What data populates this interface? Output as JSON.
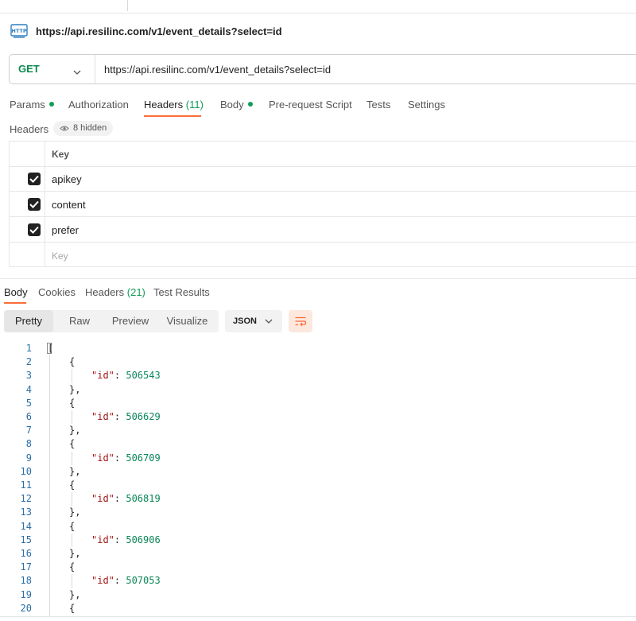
{
  "request": {
    "title": "https://api.resilinc.com/v1/event_details?select=id",
    "method": "GET",
    "url": "https://api.resilinc.com/v1/event_details?select=id",
    "icon": "http-icon"
  },
  "request_tabs": [
    {
      "label": "Params",
      "dot": true
    },
    {
      "label": "Authorization"
    },
    {
      "label": "Headers",
      "count": "(11)",
      "active": true
    },
    {
      "label": "Body",
      "dot": true
    },
    {
      "label": "Pre-request Script"
    },
    {
      "label": "Tests"
    },
    {
      "label": "Settings"
    }
  ],
  "headers_section": {
    "label": "Headers",
    "hidden_badge": "8 hidden",
    "column_key": "Key",
    "rows": [
      {
        "key": "apikey",
        "checked": true
      },
      {
        "key": "content",
        "checked": true
      },
      {
        "key": "prefer",
        "checked": true
      }
    ],
    "key_placeholder": "Key"
  },
  "response_tabs": [
    {
      "label": "Body",
      "active": true
    },
    {
      "label": "Cookies"
    },
    {
      "label": "Headers",
      "count": "(21)"
    },
    {
      "label": "Test Results"
    }
  ],
  "view_modes": [
    "Pretty",
    "Raw",
    "Preview",
    "Visualize"
  ],
  "active_view": "Pretty",
  "format": "JSON",
  "code_lines": [
    {
      "n": "1",
      "t": "["
    },
    {
      "n": "2",
      "t": "{"
    },
    {
      "n": "3",
      "key": "\"id\"",
      "val": "506543"
    },
    {
      "n": "4",
      "t": "},"
    },
    {
      "n": "5",
      "t": "{"
    },
    {
      "n": "6",
      "key": "\"id\"",
      "val": "506629"
    },
    {
      "n": "7",
      "t": "},"
    },
    {
      "n": "8",
      "t": "{"
    },
    {
      "n": "9",
      "key": "\"id\"",
      "val": "506709"
    },
    {
      "n": "10",
      "t": "},"
    },
    {
      "n": "11",
      "t": "{"
    },
    {
      "n": "12",
      "key": "\"id\"",
      "val": "506819"
    },
    {
      "n": "13",
      "t": "},"
    },
    {
      "n": "14",
      "t": "{"
    },
    {
      "n": "15",
      "key": "\"id\"",
      "val": "506906"
    },
    {
      "n": "16",
      "t": "},"
    },
    {
      "n": "17",
      "t": "{"
    },
    {
      "n": "18",
      "key": "\"id\"",
      "val": "507053"
    },
    {
      "n": "19",
      "t": "},"
    },
    {
      "n": "20",
      "t": "{"
    }
  ],
  "colors": {
    "accent": "#ff6c37",
    "method_get": "#0b8a4f",
    "status_dot": "#0f9d58",
    "line_number": "#2b6ea6",
    "json_key": "#a31515",
    "json_number": "#098658"
  }
}
